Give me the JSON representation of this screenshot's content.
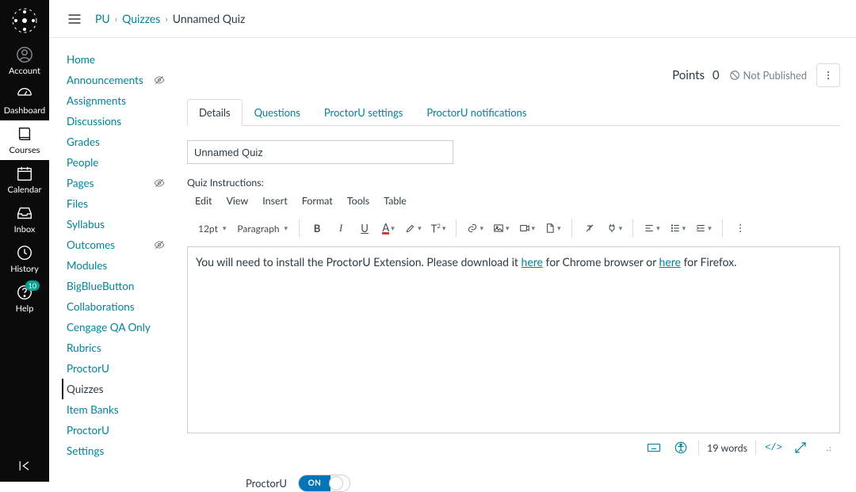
{
  "rail": {
    "items": [
      {
        "name": "account",
        "label": "Account"
      },
      {
        "name": "dashboard",
        "label": "Dashboard"
      },
      {
        "name": "courses",
        "label": "Courses",
        "active": true
      },
      {
        "name": "calendar",
        "label": "Calendar"
      },
      {
        "name": "inbox",
        "label": "Inbox"
      },
      {
        "name": "history",
        "label": "History"
      },
      {
        "name": "help",
        "label": "Help",
        "badge": "10"
      }
    ]
  },
  "breadcrumbs": {
    "course": "PU",
    "parent": "Quizzes",
    "current": "Unnamed Quiz"
  },
  "course_nav": [
    {
      "label": "Home"
    },
    {
      "label": "Announcements",
      "hidden": true
    },
    {
      "label": "Assignments"
    },
    {
      "label": "Discussions"
    },
    {
      "label": "Grades"
    },
    {
      "label": "People"
    },
    {
      "label": "Pages",
      "hidden": true
    },
    {
      "label": "Files"
    },
    {
      "label": "Syllabus"
    },
    {
      "label": "Outcomes",
      "hidden": true
    },
    {
      "label": "Modules"
    },
    {
      "label": "BigBlueButton"
    },
    {
      "label": "Collaborations"
    },
    {
      "label": "Cengage QA Only"
    },
    {
      "label": "Rubrics"
    },
    {
      "label": "ProctorU"
    },
    {
      "label": "Quizzes",
      "active": true
    },
    {
      "label": "Item Banks"
    },
    {
      "label": "ProctorU"
    },
    {
      "label": "Settings"
    }
  ],
  "header": {
    "points_label": "Points",
    "points_value": "0",
    "publish_status": "Not Published"
  },
  "tabs": [
    {
      "label": "Details",
      "active": true
    },
    {
      "label": "Questions"
    },
    {
      "label": "ProctorU settings"
    },
    {
      "label": "ProctorU notifications"
    }
  ],
  "quiz": {
    "title": "Unnamed Quiz",
    "instructions_label": "Quiz Instructions:"
  },
  "rce": {
    "menus": [
      "Edit",
      "View",
      "Insert",
      "Format",
      "Tools",
      "Table"
    ],
    "font_size": "12pt",
    "block_format": "Paragraph",
    "body_pre": "You will need to install the ProctorU Extension. Please download it ",
    "link1": "here",
    "body_mid": " for Chrome browser or ",
    "link2": "here",
    "body_post": " for Firefox.",
    "word_count": "19 words"
  },
  "proctoru": {
    "label": "ProctorU",
    "toggle_state": "ON"
  }
}
